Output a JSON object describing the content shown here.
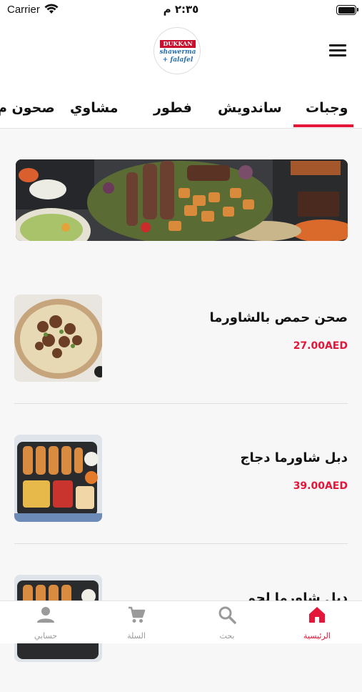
{
  "status_bar": {
    "carrier": "Carrier",
    "time": "٢:٣٥ م"
  },
  "logo": {
    "line1": "DUKKAN",
    "line2": "shawerma",
    "line3": "+ falafel"
  },
  "tabs": [
    {
      "label": "وجبات",
      "active": true
    },
    {
      "label": "ساندويش",
      "active": false
    },
    {
      "label": "فطور",
      "active": false
    },
    {
      "label": "مشاوي",
      "active": false
    },
    {
      "label": "صحون م",
      "active": false
    }
  ],
  "products": [
    {
      "name": "صحن حمص بالشاورما",
      "price": "27.00AED"
    },
    {
      "name": "دبل شاورما دجاج",
      "price": "39.00AED"
    },
    {
      "name": "دبل شاورما لحم",
      "price": ""
    }
  ],
  "bottom_nav": [
    {
      "label": "الرئيسية",
      "icon": "home-icon",
      "active": true
    },
    {
      "label": "بحث",
      "icon": "search-icon",
      "active": false
    },
    {
      "label": "السلة",
      "icon": "cart-icon",
      "active": false
    },
    {
      "label": "حسابي",
      "icon": "person-icon",
      "active": false
    }
  ],
  "colors": {
    "accent": "#e4173a",
    "inactive": "#9a9a9a"
  }
}
